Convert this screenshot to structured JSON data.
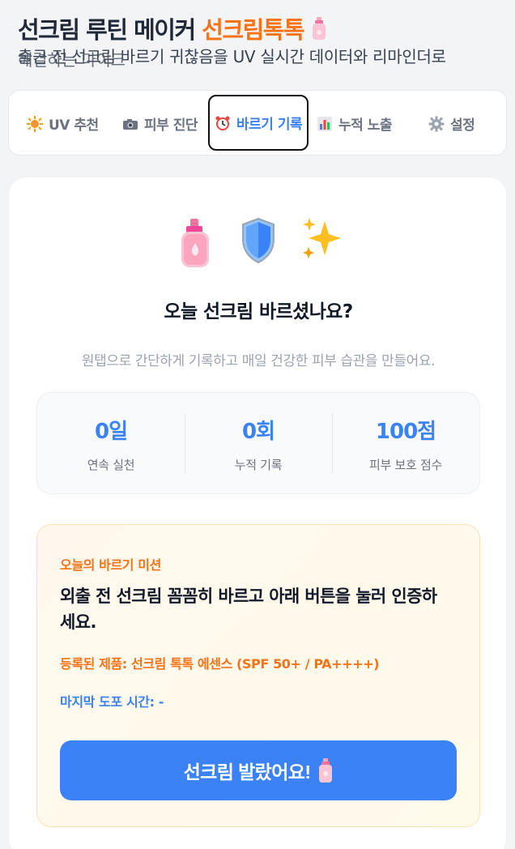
{
  "header": {
    "title_main": "선크림 루틴 메이커 ",
    "title_accent": "선크림톡톡",
    "subtitle": "출근 전 선크림 바르기 귀찮음을 UV 실시간 데이터와 리마인더로",
    "subtitle_overlap": "해결하는 마이크"
  },
  "tabs": [
    {
      "label": "UV 추천",
      "icon": "sun-icon"
    },
    {
      "label": "피부 진단",
      "icon": "camera-icon"
    },
    {
      "label": "바르기 기록",
      "icon": "alarm-clock-icon"
    },
    {
      "label": "누적 노출",
      "icon": "bar-chart-icon"
    },
    {
      "label": "설정",
      "icon": "gear-icon"
    }
  ],
  "active_tab": "바르기 기록",
  "main": {
    "question": "오늘 선크림 바르셨나요?",
    "description": "원탭으로 간단하게 기록하고 매일 건강한 피부 습관을 만들어요.",
    "stats": [
      {
        "value": "0일",
        "label": "연속 실천"
      },
      {
        "value": "0회",
        "label": "누적 기록"
      },
      {
        "value": "100점",
        "label": "피부 보호 점수"
      }
    ]
  },
  "mission": {
    "label": "오늘의 바르기 미션",
    "text": "외출 전 선크림 꼼꼼히 바르고 아래 버튼을 눌러 인증하세요.",
    "product": "등록된 제품: 선크림 톡톡 에센스 (SPF 50+ / PA++++)",
    "last_time": "마지막 도포 시간: -",
    "button_label": "선크림 발랐어요!"
  },
  "colors": {
    "accent_orange": "#f97316",
    "primary_blue": "#3b82f6",
    "background": "#f3f4f6"
  }
}
